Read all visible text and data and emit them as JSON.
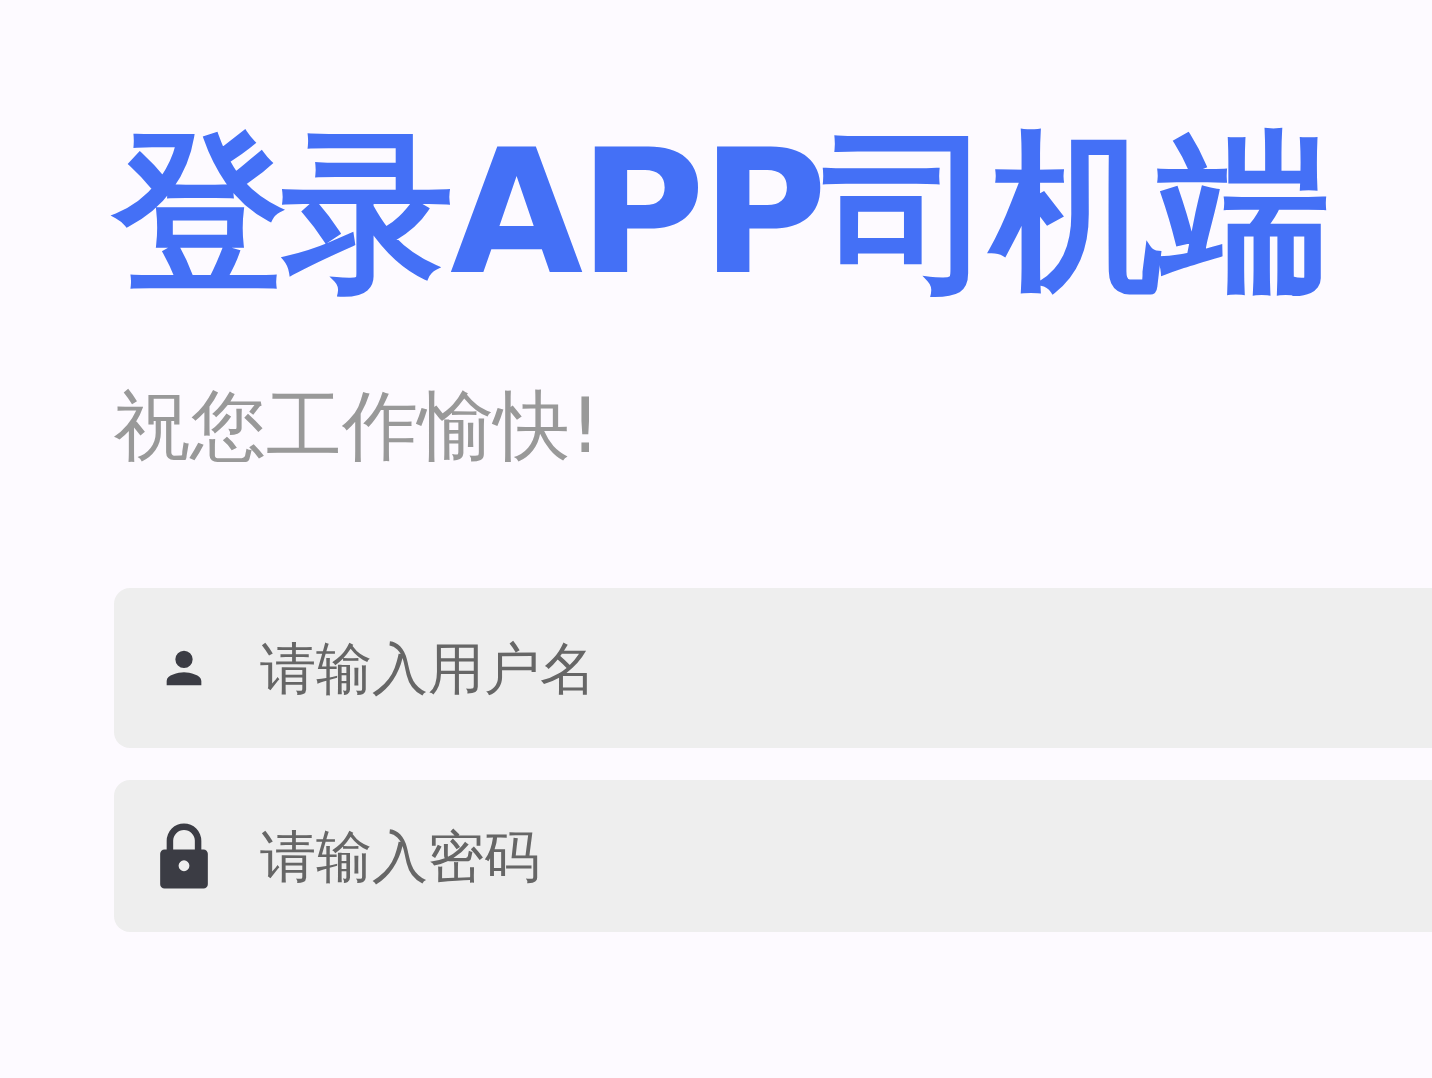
{
  "title": {
    "text": "登录APP司机端"
  },
  "subtitle": {
    "text": "祝您工作愉快!"
  },
  "fields": [
    {
      "kind": "user",
      "placeholder": "请输入用户名"
    },
    {
      "kind": "lock",
      "placeholder": "请输入密码"
    }
  ]
}
